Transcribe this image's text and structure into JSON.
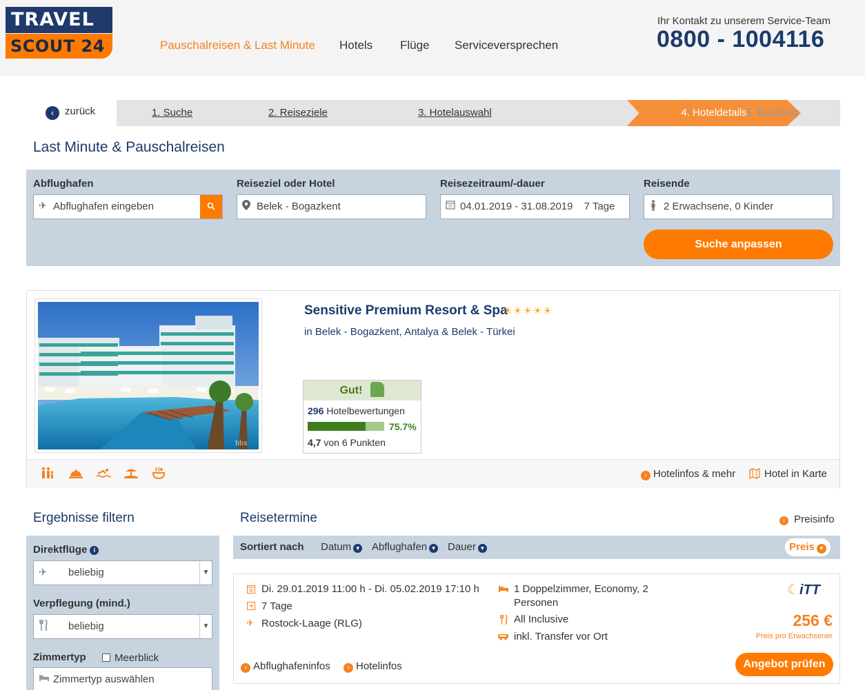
{
  "header": {
    "logo_top": "TRAVEL",
    "logo_bottom": "SCOUT 24",
    "nav": [
      "Pauschalreisen & Last Minute",
      "Hotels",
      "Flüge",
      "Serviceversprechen"
    ],
    "contact_label": "Ihr Kontakt zu unserem Service-Team",
    "phone": "0800 - 1004116"
  },
  "steps": {
    "back": "zurück",
    "items": [
      "1. Suche",
      "2. Reiseziele",
      "3. Hotelauswahl",
      "4. Hoteldetails",
      "5. Buchung"
    ]
  },
  "page_title": "Last Minute & Pauschalreisen",
  "search": {
    "airport_label": "Abflughafen",
    "airport_placeholder": "Abflughafen eingeben",
    "destination_label": "Reiseziel oder Hotel",
    "destination_value": "Belek - Bogazkent",
    "period_label": "Reisezeitraum/-dauer",
    "period_value": "04.01.2019 - 31.08.2019",
    "duration_value": "7 Tage",
    "travelers_label": "Reisende",
    "travelers_value": "2 Erwachsene, 0 Kinder",
    "submit": "Suche anpassen"
  },
  "hotel": {
    "name": "Sensitive Premium Resort & Spa",
    "stars": "☀☀☀☀☀",
    "location": "in Belek - Bogazkent, Antalya & Belek - Türkei",
    "watermark": "hbx",
    "rating": {
      "label": "Gut!",
      "count": "296",
      "count_label": "Hotelbewertungen",
      "percent": "75.7%",
      "percent_value": 75.7,
      "score": "4,7",
      "score_label": "von 6 Punkten"
    },
    "facilities": [
      "family-icon",
      "service-bell-icon",
      "swimming-icon",
      "beach-icon",
      "spa-icon"
    ],
    "links": [
      "Hotelinfos & mehr",
      "Hotel in Karte"
    ]
  },
  "filter": {
    "title": "Ergebnisse filtern",
    "direct_label": "Direktflüge",
    "direct_value": "beliebig",
    "board_label": "Verpflegung (mind.)",
    "board_value": "beliebig",
    "room_label": "Zimmertyp",
    "room_check": "Meerblick",
    "room_placeholder": "Zimmertyp auswählen"
  },
  "results": {
    "title": "Reisetermine",
    "priceinfo": "Preisinfo",
    "sort_label": "Sortiert nach",
    "sort_options": [
      "Datum",
      "Abflughafen",
      "Dauer"
    ],
    "sort_active": "Preis"
  },
  "offer": {
    "dates": "Di. 29.01.2019 11:00 h - Di. 05.02.2019 17:10 h",
    "duration": "7 Tage",
    "airport": "Rostock-Laage (RLG)",
    "room_line1": "1 Doppelzimmer, Economy, 2",
    "room_line2": "Personen",
    "board": "All Inclusive",
    "transfer": "inkl. Transfer vor Ort",
    "operator": "iTT",
    "price": "256 €",
    "price_note": "Preis pro Erwachsener",
    "link_airport": "Abflughafeninfos",
    "link_hotel": "Hotelinfos",
    "button": "Angebot prüfen"
  },
  "colors": {
    "brand_navy": "#1c3a6b",
    "brand_orange": "#ff7a00",
    "panel_blue": "#c7d4e0",
    "rating_green": "#3f7f1f"
  }
}
